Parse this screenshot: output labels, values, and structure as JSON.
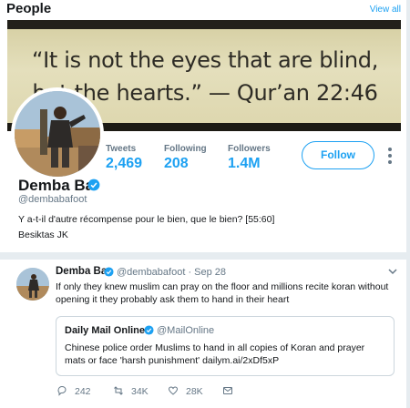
{
  "header": {
    "title": "People",
    "view_all": "View all"
  },
  "banner": {
    "line1": "“It is not the eyes that are blind,",
    "line2": "but the hearts.” — Qur’an 22:46"
  },
  "profile": {
    "stats": [
      {
        "label": "Tweets",
        "value": "2,469"
      },
      {
        "label": "Following",
        "value": "208"
      },
      {
        "label": "Followers",
        "value": "1.4M"
      }
    ],
    "follow_label": "Follow",
    "name": "Demba Ba",
    "handle": "@dembabafoot",
    "bio": "Y a-t-il d'autre récompense pour le bien, que le bien? [55:60]",
    "location": "Besiktas JK"
  },
  "tweet": {
    "name": "Demba Ba",
    "handle_date": "@dembabafoot · Sep 28",
    "text": "If only they knew muslim can pray on the floor and millions recite koran without opening it they probably ask them to hand in their heart",
    "quote": {
      "name": "Daily Mail Online",
      "handle": "@MailOnline",
      "text": "Chinese police order Muslims to hand in all copies of Koran and prayer mats or face 'harsh punishment' dailym.ai/2xDf5xP"
    },
    "actions": {
      "replies": "242",
      "retweets": "34K",
      "likes": "28K"
    }
  },
  "colors": {
    "accent": "#1da1f2",
    "muted": "#657786",
    "text": "#14171a",
    "border": "#ccd6dd"
  }
}
